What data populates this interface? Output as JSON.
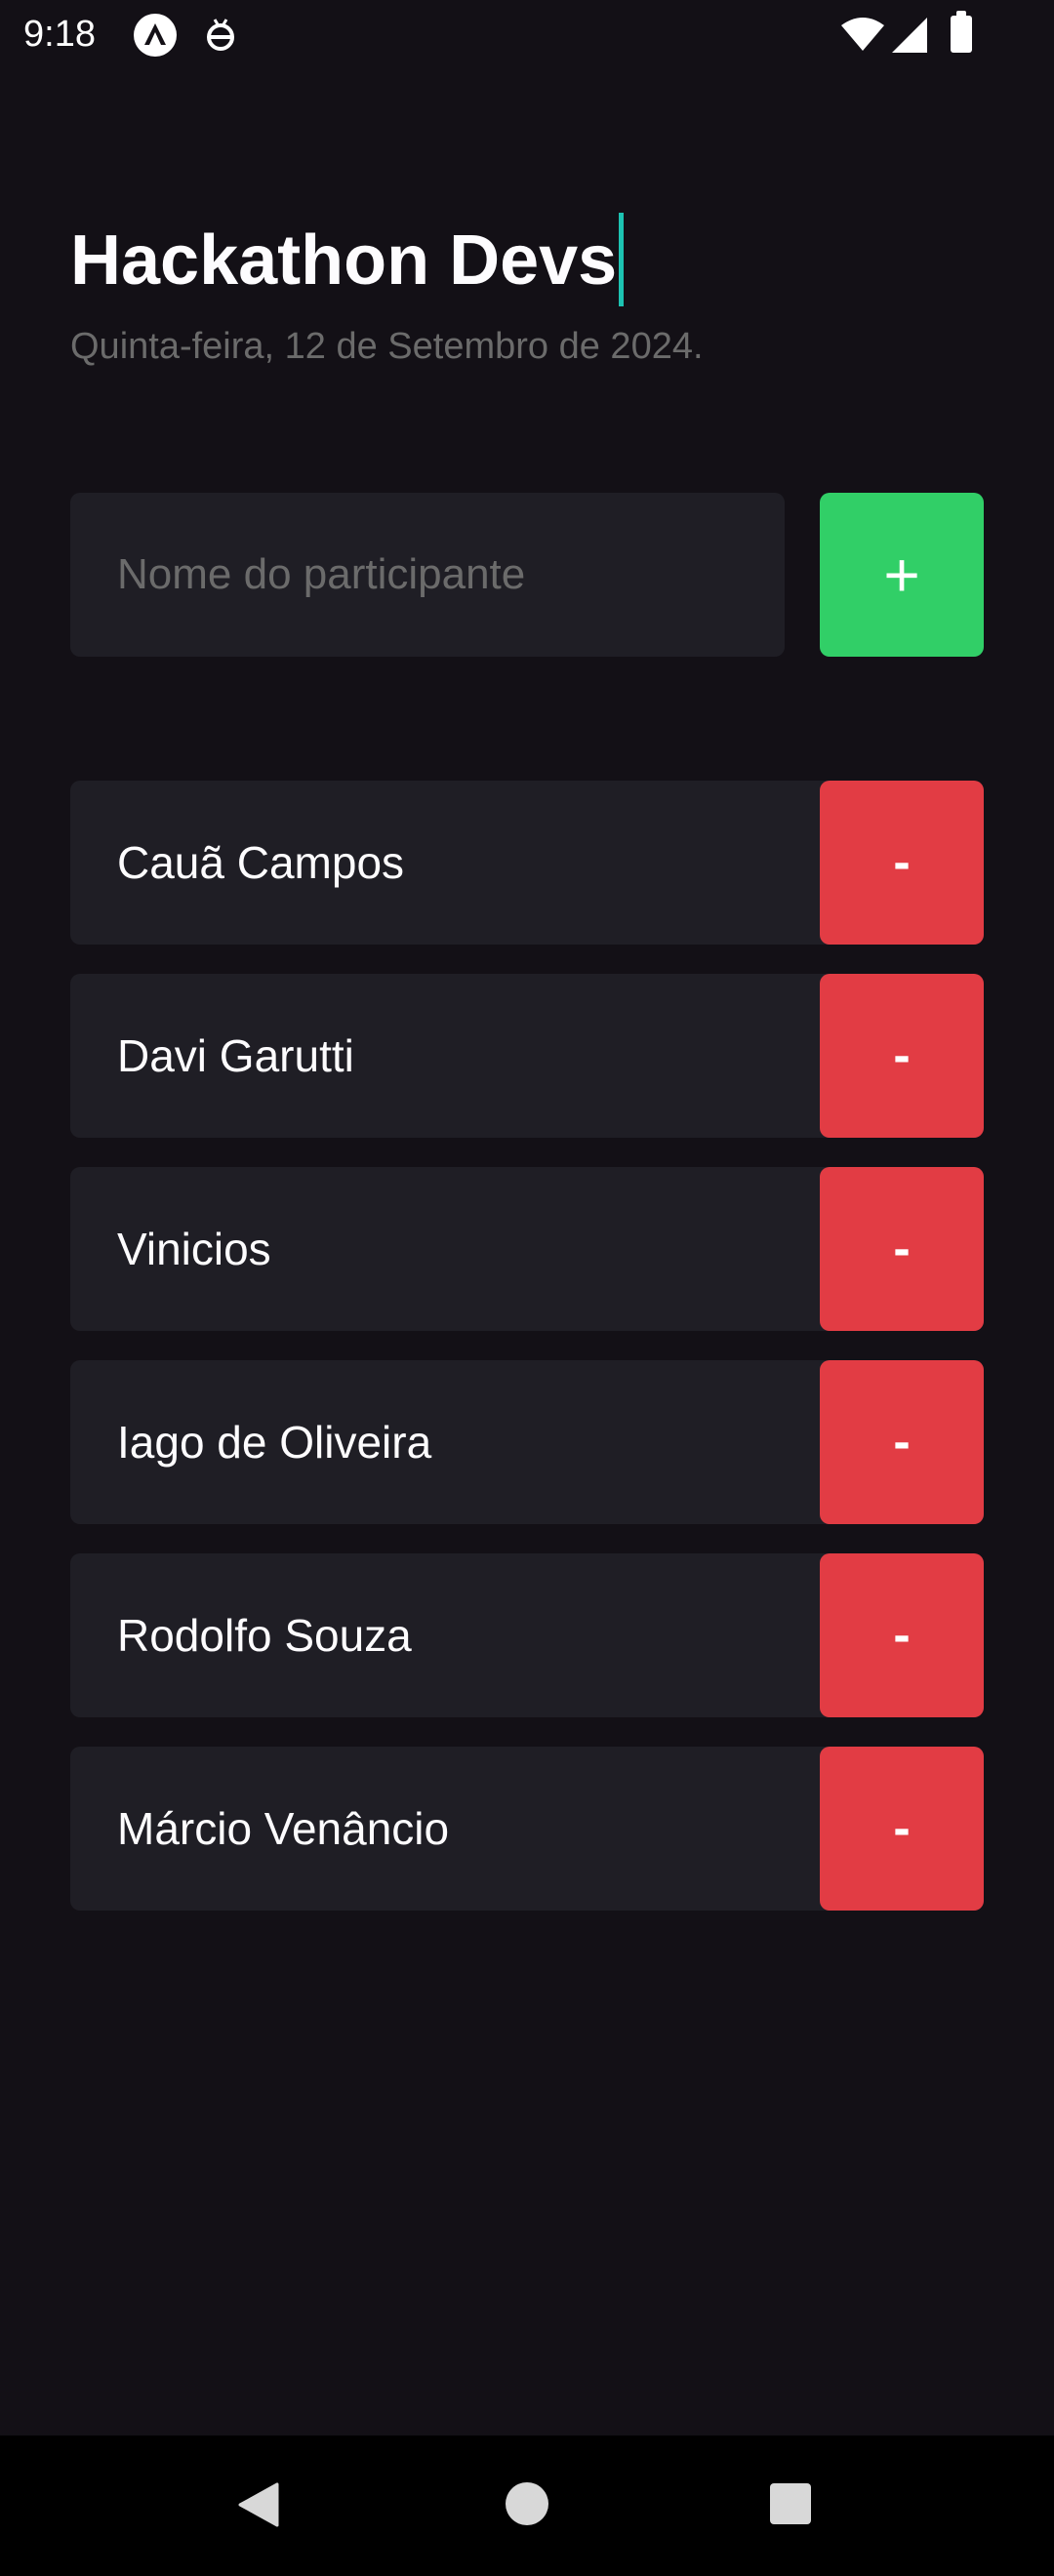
{
  "status_bar": {
    "time": "9:18",
    "icons": [
      "expo-app-icon",
      "debug-icon",
      "wifi-icon",
      "cell-signal-icon",
      "battery-icon"
    ]
  },
  "header": {
    "title": "Hackathon Devs",
    "date": "Quinta-feira, 12 de Setembro de 2024."
  },
  "form": {
    "input_placeholder": "Nome do participante",
    "input_value": "",
    "add_label": "+"
  },
  "participants": [
    {
      "name": "Cauã Campos",
      "remove_label": "-"
    },
    {
      "name": "Davi Garutti",
      "remove_label": "-"
    },
    {
      "name": "Vinicios",
      "remove_label": "-"
    },
    {
      "name": "Iago de Oliveira",
      "remove_label": "-"
    },
    {
      "name": "Rodolfo Souza",
      "remove_label": "-"
    },
    {
      "name": "Márcio Venâncio",
      "remove_label": "-"
    }
  ],
  "nav_bar": {
    "icons": [
      "back-icon",
      "home-icon",
      "recents-icon"
    ]
  },
  "colors": {
    "background": "#131016",
    "surface": "#1F1E25",
    "text": "#FDFCFE",
    "muted": "#6B6B6B",
    "add": "#31CF67",
    "remove": "#E23C44",
    "cursor": "#1DC3B2"
  }
}
